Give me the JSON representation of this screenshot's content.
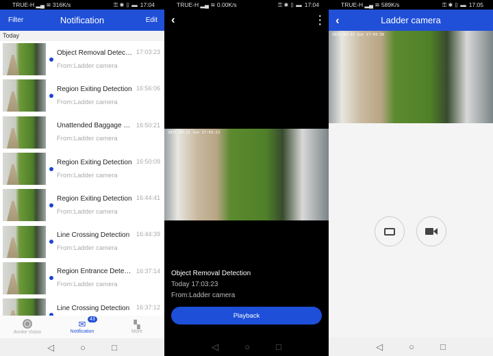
{
  "panel1": {
    "status": {
      "carrier": "TRUE-H",
      "speed": "316K/s",
      "time": "17:04"
    },
    "header": {
      "filter": "Filter",
      "title": "Notification",
      "edit": "Edit"
    },
    "section": "Today",
    "items": [
      {
        "title": "Object Removal Detecti...",
        "from": "From:Ladder camera",
        "time": "17:03:23",
        "unread": true
      },
      {
        "title": "Region Exiting Detection",
        "from": "From:Ladder camera",
        "time": "16:56:06",
        "unread": true
      },
      {
        "title": "Unattended Baggage D...",
        "from": "From:Ladder camera",
        "time": "16:50:21",
        "unread": false
      },
      {
        "title": "Region Exiting Detection",
        "from": "From:Ladder camera",
        "time": "16:50:09",
        "unread": true
      },
      {
        "title": "Region Exiting Detection",
        "from": "From:Ladder camera",
        "time": "16:44:41",
        "unread": true
      },
      {
        "title": "Line Crossing Detection",
        "from": "From:Ladder camera",
        "time": "16:44:39",
        "unread": true
      },
      {
        "title": "Region Entrance Detect...",
        "from": "From:Ladder camera",
        "time": "16:37:14",
        "unread": true
      },
      {
        "title": "Line Crossing Detection",
        "from": "From:Ladder camera",
        "time": "16:37:12",
        "unread": true
      }
    ],
    "tabs": [
      {
        "label": "Annke Vision",
        "icon": "camera-lens-icon"
      },
      {
        "label": "Notification",
        "icon": "mail-icon",
        "badge": "43",
        "active": true
      },
      {
        "label": "More",
        "icon": "grid-icon"
      }
    ]
  },
  "panel2": {
    "status": {
      "carrier": "TRUE-H",
      "speed": "0.00K/s",
      "time": "17:04"
    },
    "video_timestamp": "2021-03-21 Sun 17:03:23",
    "event_title": "Object Removal Detection",
    "event_time": "Today 17:03:23",
    "event_from": "From:Ladder camera",
    "playback": "Playback"
  },
  "panel3": {
    "status": {
      "carrier": "TRUE-H",
      "speed": "589K/s",
      "time": "17:05"
    },
    "title": "Ladder camera",
    "video_timestamp": "2021-03-21 Sun 17:03:38"
  },
  "colors": {
    "accent": "#2150d8"
  }
}
